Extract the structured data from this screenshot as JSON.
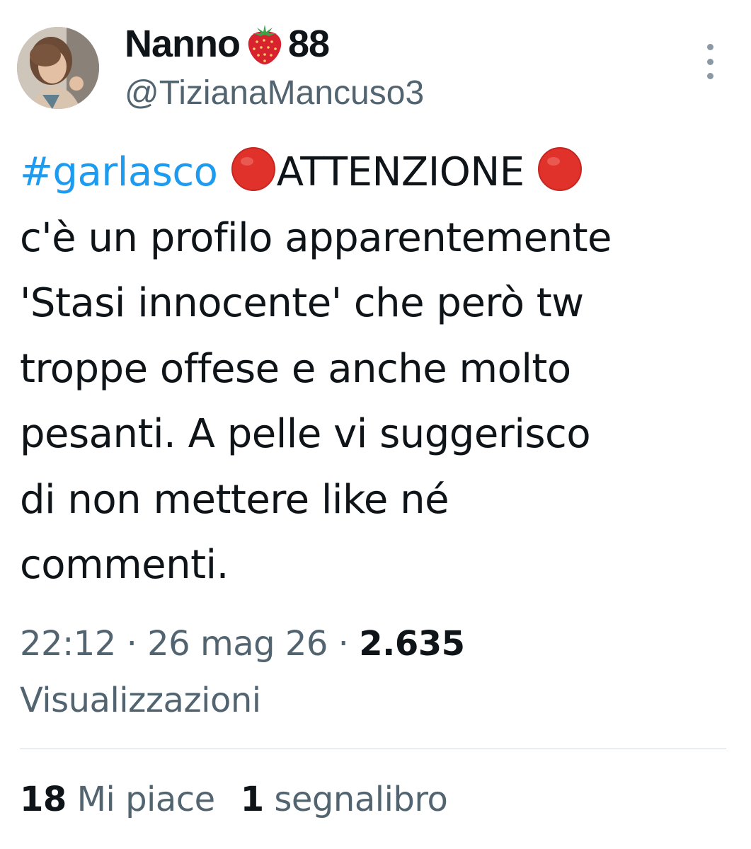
{
  "author": {
    "name_prefix": "Nanno",
    "name_suffix": "88",
    "name_emoji": "strawberry-icon",
    "handle": "@TizianaMancuso3"
  },
  "tweet": {
    "hashtag": "#garlasco",
    "lines": {
      "l1_text": "ATTENZIONE",
      "l2": "c'è un profilo apparentemente",
      "l3": "'Stasi innocente' che però tw",
      "l4": "troppe offese e anche molto",
      "l5": "pesanti. A pelle vi suggerisco",
      "l6": "di non mettere like né",
      "l7": "commenti."
    },
    "emoji": "red-circle-icon"
  },
  "meta": {
    "time": "22:12",
    "separator": " · ",
    "date": "26 mag 26",
    "views_count": "2.635",
    "views_label": "Visualizzazioni"
  },
  "stats": {
    "likes_count": "18",
    "likes_label": "Mi piace",
    "bookmarks_count": "1",
    "bookmarks_label": "segnalibro"
  },
  "colors": {
    "text": "#0f1419",
    "secondary": "#536471",
    "link": "#1d9bf0",
    "divider": "#cfd9de",
    "red_circle": "#e0322b"
  }
}
